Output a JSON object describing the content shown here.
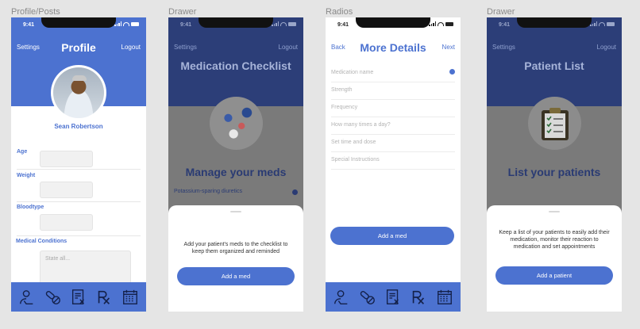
{
  "frames": [
    {
      "title": "Profile/Posts"
    },
    {
      "title": "Drawer"
    },
    {
      "title": "Radios"
    },
    {
      "title": "Drawer"
    }
  ],
  "status": {
    "time": "9:41"
  },
  "profile": {
    "nav_left": "Settings",
    "nav_title": "Profile",
    "nav_right": "Logout",
    "name": "Sean Robertson",
    "fields": [
      {
        "label": "Age"
      },
      {
        "label": "Weight"
      },
      {
        "label": "Bloodtype"
      },
      {
        "label": "Medical Conditions"
      }
    ],
    "conditions_placeholder": "State all..."
  },
  "meds_drawer": {
    "nav_left": "Settings",
    "nav_right": "Logout",
    "title": "Medication Checklist",
    "heading": "Manage your meds",
    "list_item": "Potassium-sparing diuretics",
    "sheet_text": "Add your patient's meds to the checklist to keep them organized and reminded",
    "button": "Add a med"
  },
  "details": {
    "nav_left": "Back",
    "nav_title": "More Details",
    "nav_right": "Next",
    "fields": [
      {
        "label": "Medication name"
      },
      {
        "label": "Strength"
      },
      {
        "label": "Frequency"
      },
      {
        "label": "How many times a day?"
      },
      {
        "label": "Set time and dose"
      },
      {
        "label": "Special Instructions"
      }
    ],
    "button": "Add a med"
  },
  "patients_drawer": {
    "nav_left": "Settings",
    "nav_right": "Logout",
    "title": "Patient List",
    "heading": "List your patients",
    "sheet_text": "Keep a list of your patients to easily add their medication, monitor their reaction to medication and set appointments",
    "button": "Add a patient"
  },
  "tabbar_icons": [
    "user-icon",
    "pills-icon",
    "prescription-doc-icon",
    "rx-icon",
    "calendar-icon"
  ],
  "colors": {
    "accent": "#4c72d0",
    "dim_top": "#2c3e78",
    "dim_overlay": "#7a7a7a"
  }
}
